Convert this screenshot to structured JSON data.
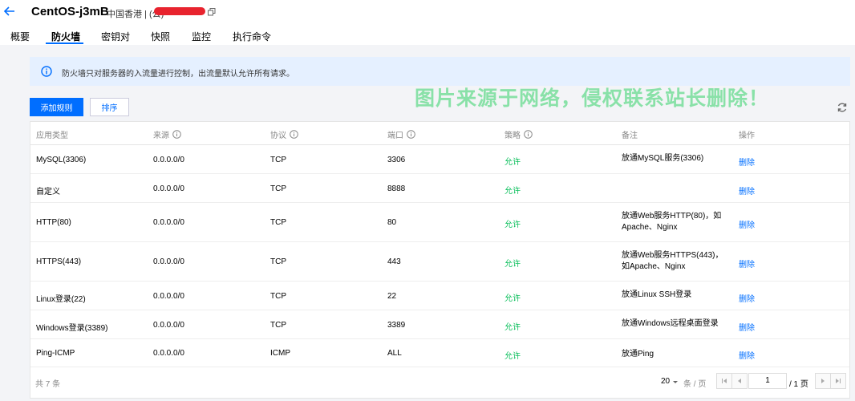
{
  "header": {
    "title": "CentOS-j3mB",
    "region": "中国香港 | (公)"
  },
  "tabs": [
    {
      "label": "概要"
    },
    {
      "label": "防火墙"
    },
    {
      "label": "密钥对"
    },
    {
      "label": "快照"
    },
    {
      "label": "监控"
    },
    {
      "label": "执行命令"
    }
  ],
  "notice": {
    "text": "防火墙只对服务器的入流量进行控制，出流量默认允许所有请求。"
  },
  "watermark": "图片来源于网络，侵权联系站长删除！",
  "toolbar": {
    "add_label": "添加规则",
    "sort_label": "排序"
  },
  "table": {
    "columns": [
      "应用类型",
      "来源",
      "协议",
      "端口",
      "策略",
      "备注",
      "操作"
    ],
    "rows": [
      {
        "app": "MySQL(3306)",
        "source": "0.0.0.0/0",
        "protocol": "TCP",
        "port": "3306",
        "policy": "允许",
        "note": "放通MySQL服务(3306)",
        "action": "删除"
      },
      {
        "app": "自定义",
        "source": "0.0.0.0/0",
        "protocol": "TCP",
        "port": "8888",
        "policy": "允许",
        "note": "",
        "action": "删除"
      },
      {
        "app": "HTTP(80)",
        "source": "0.0.0.0/0",
        "protocol": "TCP",
        "port": "80",
        "policy": "允许",
        "note": "放通Web服务HTTP(80)，如Apache、Nginx",
        "action": "删除"
      },
      {
        "app": "HTTPS(443)",
        "source": "0.0.0.0/0",
        "protocol": "TCP",
        "port": "443",
        "policy": "允许",
        "note": "放通Web服务HTTPS(443)，如Apache、Nginx",
        "action": "删除"
      },
      {
        "app": "Linux登录(22)",
        "source": "0.0.0.0/0",
        "protocol": "TCP",
        "port": "22",
        "policy": "允许",
        "note": "放通Linux SSH登录",
        "action": "删除"
      },
      {
        "app": "Windows登录(3389)",
        "source": "0.0.0.0/0",
        "protocol": "TCP",
        "port": "3389",
        "policy": "允许",
        "note": "放通Windows远程桌面登录",
        "action": "删除"
      },
      {
        "app": "Ping-ICMP",
        "source": "0.0.0.0/0",
        "protocol": "ICMP",
        "port": "ALL",
        "policy": "允许",
        "note": "放通Ping",
        "action": "删除"
      }
    ]
  },
  "pagination": {
    "total_text": "共 7 条",
    "page_size": "20",
    "per_page_label": "条 / 页",
    "current_page": "1",
    "total_pages": "/ 1 页"
  },
  "colors": {
    "accent": "#006eff",
    "allow": "#0abf5b",
    "notice_bg": "#e5f0ff"
  }
}
